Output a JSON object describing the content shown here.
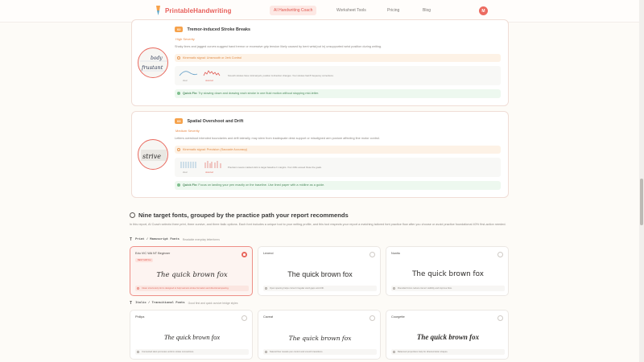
{
  "nav": {
    "brand": "PrintableHandwriting",
    "links": [
      "AI Handwriting Coach",
      "Worksheet Tools",
      "Pricing",
      "Blog"
    ],
    "avatar": "M"
  },
  "issues": [
    {
      "number": "02",
      "title": "Tremor-induced Stroke Breaks",
      "severity": "High Severity",
      "description": "Shaky lines and jagged curves suggest hand tremor or excessive grip tension likely caused by bent wrist(out in) unsupported wrist position during writing.",
      "signal": "Kinematic signal: Unsmooth or Jerk Control",
      "viz_caption": "Smooth strokes have minimal jerk, position & direction changes. Your strokes had 8 frequency corrections.",
      "viz_labels": [
        "ideal",
        "detected"
      ],
      "quick_fix_label": "Quick Fix:",
      "quick_fix": "Try slowing down and drawing each stroke in one fluid motion without stopping mid-letter.",
      "sample_words": [
        "body",
        "frustant"
      ]
    },
    {
      "number": "03",
      "title": "Spatial Overshoot and Drift",
      "severity": "Medium Severity",
      "description": "Letters overshoot intended boundaries and drift laterally, may stem from inadequate desk support or misaligned arm posture affecting fine motor control.",
      "signal": "Kinematic signal: Precision (Saccade Accuracy)",
      "viz_caption": "Precision means marked stick to target baseline ± margins. Your drifts exceed those the goals.",
      "viz_labels": [
        "ideal",
        "detected"
      ],
      "quick_fix_label": "Quick Fix:",
      "quick_fix": "Focus on landing your pen exactly on the baseline. Use lined paper with a midline as a guide.",
      "sample_words": [
        "strive"
      ]
    }
  ],
  "fonts_section": {
    "heading": "Nine target fonts, grouped by the practice path your report recommends",
    "intro": "In this report, AI Coach selects three print, three cursive, and three italic options. Each font includes a unique tool to your writing profile, and this tool respects your report a matching tailored font practice flow after you choose or avoid practice foundational 40% first-action needed.",
    "groups": [
      {
        "icon": "T",
        "title": "Print / Manuscript Fonts",
        "subtitle": "Readable everyday letterforms",
        "fonts": [
          {
            "name": "Edu VIC WA NT Beginner",
            "badge": "BEST MATCH",
            "sample": "The quick brown fox",
            "note": "Clean structured print is designed to help learners stroke formation and directional spacing.",
            "selected": true
          },
          {
            "name": "Lexend",
            "sample": "The quick brown fox",
            "note": "Open spacing helps correct irregular word gaps and drift.",
            "selected": false
          },
          {
            "name": "Nunito",
            "sample": "The quick brown fox",
            "note": "Rounded forms reduce tremor visibility and improve flow.",
            "selected": false
          }
        ]
      },
      {
        "icon": "T",
        "title": "Italic / Transitional Fonts",
        "subtitle": "Good first and quick cursive bridge styles",
        "fonts": [
          {
            "name": "Philipa",
            "sample": "The quick brown fox",
            "note": "Connected slant promotes uniform stroke connections.",
            "selected": false
          },
          {
            "name": "Caveat",
            "sample": "The quick brown fox",
            "note": "Natural flow reveals pen control and smooth transitions.",
            "selected": false
          },
          {
            "name": "Courgette",
            "sample": "The quick brown fox",
            "note": "Balanced proportions help for directed letter shapes.",
            "selected": false
          }
        ]
      }
    ]
  },
  "colors": {
    "brand": "#e85f5a",
    "severity_high": "#e98a48",
    "quick_fix_bg": "#edf8ef",
    "selected_border": "#ee8f87"
  }
}
